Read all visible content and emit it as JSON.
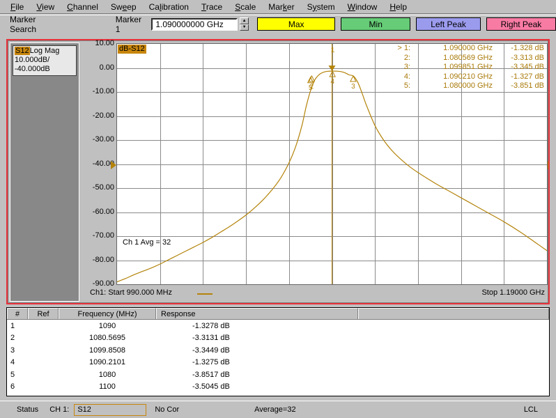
{
  "menu": {
    "items": [
      {
        "label": "File",
        "mnemonic": "F"
      },
      {
        "label": "View",
        "mnemonic": "V"
      },
      {
        "label": "Channel",
        "mnemonic": "C"
      },
      {
        "label": "Sweep",
        "mnemonic": "e"
      },
      {
        "label": "Calibration",
        "mnemonic": "l"
      },
      {
        "label": "Trace",
        "mnemonic": "T"
      },
      {
        "label": "Scale",
        "mnemonic": "S"
      },
      {
        "label": "Marker",
        "mnemonic": "k"
      },
      {
        "label": "System",
        "mnemonic": "y"
      },
      {
        "label": "Window",
        "mnemonic": "W"
      },
      {
        "label": "Help",
        "mnemonic": "H"
      }
    ]
  },
  "toolbar": {
    "title": "Marker Search",
    "marker_label": "Marker 1",
    "marker_value": "1.090000000 GHz",
    "spin_up": "▲",
    "spin_down": "▼",
    "max_label": "Max",
    "min_label": "Min",
    "left_peak_label": "Left Peak",
    "right_peak_label": "Right Peak",
    "max_color": "#ffff00",
    "min_color": "#66cc77",
    "left_peak_color": "#9b9bee",
    "right_peak_color": "#f87ba4"
  },
  "trace_panel": {
    "param": "S12",
    "format": "Log Mag",
    "scale_per_div": "10.000dB/",
    "reference": "-40.000dB"
  },
  "plot": {
    "db_tag": "dB-S12",
    "avg_note": "Ch 1 Avg = 32",
    "trace_color": "#b4830a",
    "grid_color": "#8a8a8a",
    "background": "#ffffff"
  },
  "marker_readout": [
    {
      "sel": ">",
      "idx": "1:",
      "freq": "1.090000 GHz",
      "resp": "-1.328 dB"
    },
    {
      "sel": "",
      "idx": "2:",
      "freq": "1.080569 GHz",
      "resp": "-3.313 dB"
    },
    {
      "sel": "",
      "idx": "3:",
      "freq": "1.099851 GHz",
      "resp": "-3.345 dB"
    },
    {
      "sel": "",
      "idx": "4:",
      "freq": "1.090210 GHz",
      "resp": "-1.327 dB"
    },
    {
      "sel": "",
      "idx": "5:",
      "freq": "1.080000 GHz",
      "resp": "-3.851 dB"
    }
  ],
  "sweep": {
    "channel": "Ch1:",
    "start_label": "Start",
    "start_value": "990.000 MHz",
    "stop_label": "Stop",
    "stop_value": "1.19000 GHz"
  },
  "marker_table": {
    "headers": [
      "#",
      "Ref",
      "Frequency (MHz)",
      "Response",
      ""
    ],
    "rows": [
      {
        "n": "1",
        "ref": "",
        "freq": "1090",
        "resp": "-1.3278 dB"
      },
      {
        "n": "2",
        "ref": "",
        "freq": "1080.5695",
        "resp": "-3.3131 dB"
      },
      {
        "n": "3",
        "ref": "",
        "freq": "1099.8508",
        "resp": "-3.3449 dB"
      },
      {
        "n": "4",
        "ref": "",
        "freq": "1090.2101",
        "resp": "-1.3275 dB"
      },
      {
        "n": "5",
        "ref": "",
        "freq": "1080",
        "resp": "-3.8517 dB"
      },
      {
        "n": "6",
        "ref": "",
        "freq": "1100",
        "resp": "-3.5045 dB"
      }
    ]
  },
  "status": {
    "label": "Status",
    "channel": "CH 1:",
    "param": "S12",
    "correction": "No Cor",
    "average": "Average=32",
    "lock": "LCL"
  },
  "chart_data": {
    "type": "line",
    "title": "dB-S12",
    "xlabel": "Frequency",
    "ylabel": "dB-S12",
    "xlim": [
      990,
      1190
    ],
    "xunit": "MHz",
    "ylim": [
      -90,
      10
    ],
    "yticks": [
      10.0,
      0.0,
      -10.0,
      -20.0,
      -30.0,
      -40.0,
      -50.0,
      -60.0,
      -70.0,
      -80.0,
      -90.0
    ],
    "ytick_labels": [
      "10.00",
      "0.00",
      "-10.00",
      "-20.00",
      "-30.00",
      "-40.00",
      "-50.00",
      "-60.00",
      "-70.00",
      "-80.00",
      "-90.00"
    ],
    "scale_per_div": 10.0,
    "reference_value": -40.0,
    "grid": true,
    "grid_divisions_x": 10,
    "grid_divisions_y": 10,
    "series": [
      {
        "name": "S12",
        "color": "#b4830a",
        "x": [
          990,
          994,
          998,
          1002,
          1006,
          1010,
          1014,
          1018,
          1022,
          1026,
          1030,
          1034,
          1038,
          1042,
          1046,
          1050,
          1054,
          1058,
          1062,
          1066,
          1070,
          1073,
          1076,
          1078,
          1080,
          1082,
          1084,
          1086,
          1088,
          1090,
          1092,
          1094,
          1096,
          1098,
          1100,
          1102,
          1104,
          1106,
          1110,
          1114,
          1118,
          1122,
          1126,
          1130,
          1138,
          1146,
          1154,
          1162,
          1170,
          1178,
          1186,
          1190
        ],
        "y": [
          -89.0,
          -87.6,
          -86.0,
          -84.6,
          -83.2,
          -81.6,
          -79.8,
          -78.0,
          -76.2,
          -74.4,
          -72.6,
          -70.6,
          -68.4,
          -66.2,
          -63.8,
          -61.2,
          -58.2,
          -54.8,
          -50.8,
          -46.0,
          -39.5,
          -33.0,
          -24.0,
          -16.0,
          -9.5,
          -5.0,
          -2.8,
          -1.8,
          -1.4,
          -1.33,
          -1.35,
          -1.5,
          -2.0,
          -2.9,
          -3.4,
          -6.0,
          -10.5,
          -15.5,
          -24.0,
          -30.0,
          -34.5,
          -38.0,
          -41.0,
          -43.5,
          -48.0,
          -52.0,
          -56.0,
          -60.0,
          -64.0,
          -68.5,
          -73.5,
          -76.0
        ]
      }
    ],
    "markers": [
      {
        "id": "1",
        "freq_ghz": 1.09,
        "resp_db": -1.328,
        "active": true
      },
      {
        "id": "2",
        "freq_ghz": 1.080569,
        "resp_db": -3.313,
        "active": false
      },
      {
        "id": "3",
        "freq_ghz": 1.099851,
        "resp_db": -3.345,
        "active": false
      },
      {
        "id": "4",
        "freq_ghz": 1.09021,
        "resp_db": -1.327,
        "active": false
      },
      {
        "id": "5",
        "freq_ghz": 1.08,
        "resp_db": -3.851,
        "active": false
      }
    ],
    "annotations": [
      "Ch 1 Avg = 32"
    ]
  }
}
